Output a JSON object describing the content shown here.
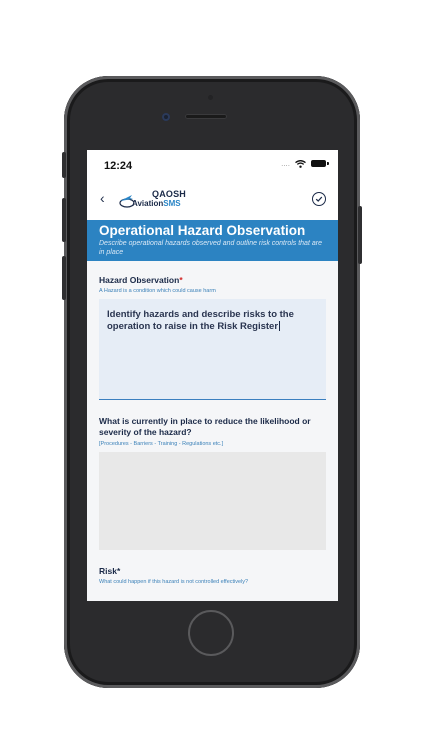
{
  "status_bar": {
    "time": "12:24",
    "signal": "....",
    "wifi_icon": "wifi-icon",
    "battery_icon": "battery-icon"
  },
  "nav": {
    "back_icon": "chevron-left-icon",
    "logo_line1": "QAOSH",
    "logo_line2a": "Aviation",
    "logo_line2b": "SMS",
    "check_icon": "check-circle-icon"
  },
  "banner": {
    "title": "Operational Hazard Observation",
    "subtitle": "Describe operational hazards observed and outline risk controls that are in place"
  },
  "fields": {
    "hazard": {
      "label": "Hazard Observation",
      "required": "*",
      "hint": "A Hazard is a condition which could cause harm",
      "value": "Identify hazards and describe risks to the operation to raise in the Risk Register"
    },
    "controls": {
      "label": "What is currently in place to reduce the likelihood or severity of the hazard?",
      "hint": "[Procedures - Barriers - Training - Regulations etc.]",
      "value": ""
    },
    "risk": {
      "label": "Risk",
      "required": "*",
      "hint": "What could happen if this hazard is not controlled effectively?"
    }
  },
  "colors": {
    "accent": "#2c83c2",
    "navy": "#1b2a48",
    "required": "#d22727"
  }
}
